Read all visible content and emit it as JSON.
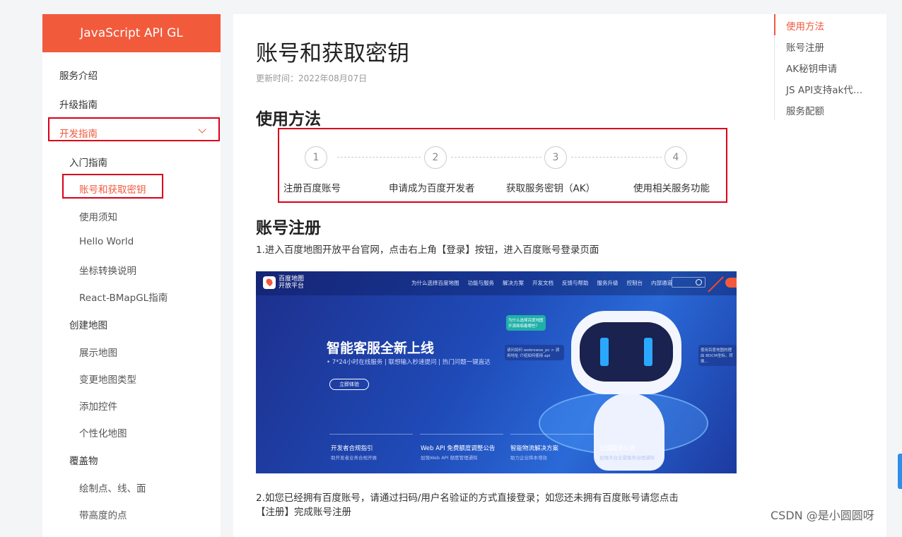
{
  "sidebar": {
    "title": "JavaScript API GL",
    "items": [
      {
        "label": "服务介绍"
      },
      {
        "label": "升级指南"
      },
      {
        "label": "开发指南"
      },
      {
        "label": "入门指南"
      },
      {
        "label": "账号和获取密钥"
      },
      {
        "label": "使用须知"
      },
      {
        "label": "Hello World"
      },
      {
        "label": "坐标转换说明"
      },
      {
        "label": "React-BMapGL指南"
      },
      {
        "label": "创建地图"
      },
      {
        "label": "展示地图"
      },
      {
        "label": "变更地图类型"
      },
      {
        "label": "添加控件"
      },
      {
        "label": "个性化地图"
      },
      {
        "label": "覆盖物"
      },
      {
        "label": "绘制点、线、面"
      },
      {
        "label": "带高度的点"
      }
    ]
  },
  "main": {
    "title": "账号和获取密钥",
    "update_time": "更新时间：2022年08月07日",
    "section1": "使用方法",
    "steps": [
      {
        "num": "1",
        "label": "注册百度账号"
      },
      {
        "num": "2",
        "label": "申请成为百度开发者"
      },
      {
        "num": "3",
        "label": "获取服务密钥（AK）"
      },
      {
        "num": "4",
        "label": "使用相关服务功能"
      }
    ],
    "section2": "账号注册",
    "para1": "1.进入百度地图开放平台官网，点击右上角【登录】按钮，进入百度账号登录页面",
    "para2_line1": "2.如您已经拥有百度账号，请通过扫码/用户名验证的方式直接登录；如您还未拥有百度账号请您点击",
    "para2_line2": "【注册】完成账号注册"
  },
  "banner": {
    "logo_line1": "百度地图",
    "logo_line2": "开放平台",
    "nav": [
      "为什么选择百度地图",
      "功能与服务",
      "解决方案",
      "开发文档",
      "反馈与帮助",
      "服务升级",
      "控制台",
      "内部通道"
    ],
    "title": "智能客服全新上线",
    "subtitle": "• 7*24小时在线服务 | 联想输入秒速提问 | 热门问题一键直达",
    "button": "立即体验",
    "bottom": [
      {
        "title": "开发者合规指引",
        "sub": "助开发者业务合规开展"
      },
      {
        "title": "Web API 免费额度调整公告",
        "sub": "加强Web API 额度管理通知"
      },
      {
        "title": "智能物流解决方案",
        "sub": "助力企业降本增效"
      },
      {
        "title": "全国服务公告",
        "sub": "加强平台全景服务治理通知"
      }
    ],
    "bubble1": "为什么选择百度地图 开源面临着哪些？",
    "bubble2": "请问如何 webrowse_pc > 调用地址 介绍如何使用 api",
    "bubble3": "使用百度地图的理由 BDCM坐标，转换…"
  },
  "toc": {
    "items": [
      "使用方法",
      "账号注册",
      "AK秘钥申请",
      "JS API支持ak代…",
      "服务配额"
    ]
  },
  "watermark": "CSDN @是小圆圆呀"
}
